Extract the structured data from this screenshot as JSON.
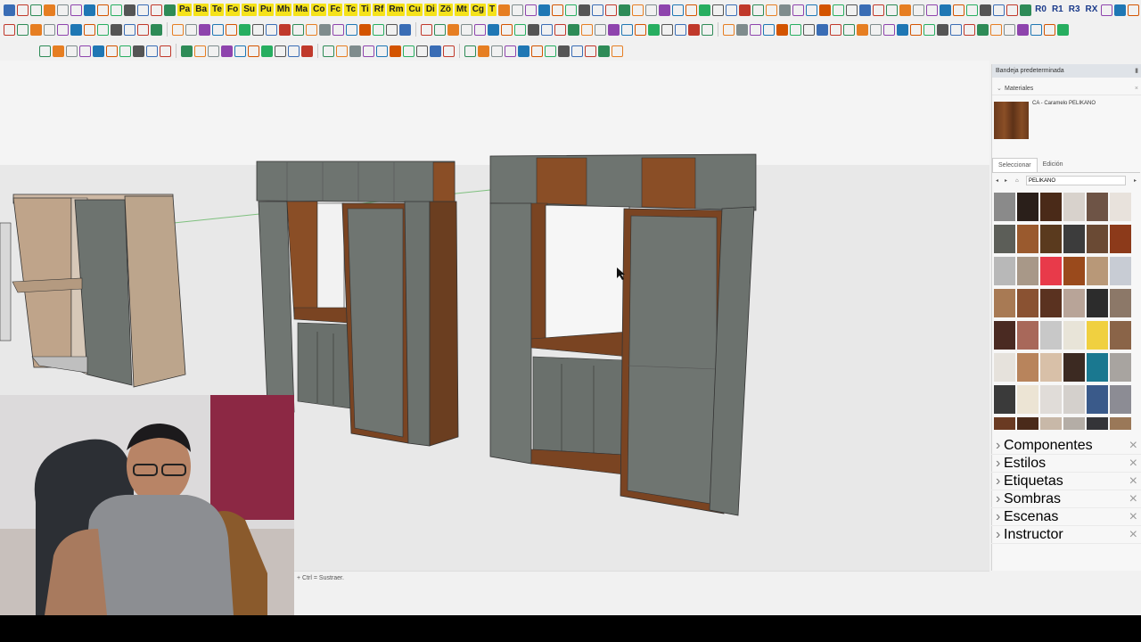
{
  "toolbar": {
    "labels": [
      "Pa",
      "Ba",
      "Te",
      "Fo",
      "Su",
      "Pu",
      "Mh",
      "Ma",
      "Co",
      "Fc",
      "Tc",
      "Ti",
      "Rf",
      "Rm",
      "Cu",
      "Di",
      "Zö",
      "Mt",
      "Cg",
      "T"
    ],
    "right_labels": [
      "R0",
      "R1",
      "R3",
      "RX"
    ],
    "icon_colors": [
      "#3a6db5",
      "#c0392b",
      "#2e8b57",
      "#e67e22",
      "#7f8c8d",
      "#8e44ad",
      "#1f77b4",
      "#d35400",
      "#27ae60",
      "#555555"
    ]
  },
  "tray": {
    "title": "Bandeja predeterminada",
    "materials_header": "Materiales",
    "material_name": "CA - Caramelo PELIKANO",
    "tab_select": "Seleccionar",
    "tab_edit": "Edición",
    "library": "PELIKANO",
    "swatches": [
      "#8a8a8a",
      "#2a1f1a",
      "#4a2a18",
      "#d8d2cc",
      "#6e5446",
      "#e8e2dc",
      "#5c5e58",
      "#9a5a2e",
      "#5a3a1e",
      "#3c3c3c",
      "#6a4a34",
      "#8c3a1a",
      "#b8b8b8",
      "#a89888",
      "#e83a4a",
      "#9a4a1c",
      "#b89878",
      "#c8ccd4",
      "#a87a54",
      "#8a5232",
      "#5a3220",
      "#b8a498",
      "#2c2c2c",
      "#8c7868",
      "#4a2a22",
      "#a8685a",
      "#c8c8c8",
      "#e8e4d8",
      "#f0d040",
      "#8a6448",
      "#e6e2dc",
      "#b8845c",
      "#d8c0a8",
      "#3c2a22",
      "#1a7890",
      "#a8a4a0",
      "#3a3a3a",
      "#ece4d4",
      "#e0dcd8",
      "#d4d0cc",
      "#3a5a8a",
      "#8c8c94",
      "#6a3a22",
      "#4a2a1a",
      "#c8b8a8",
      "#b4ada6",
      "#343438",
      "#9a7858"
    ],
    "sections": [
      "Componentes",
      "Estilos",
      "Etiquetas",
      "Sombras",
      "Escenas",
      "Instructor"
    ]
  },
  "status": {
    "hint": "+ Ctrl = Sustraer."
  }
}
